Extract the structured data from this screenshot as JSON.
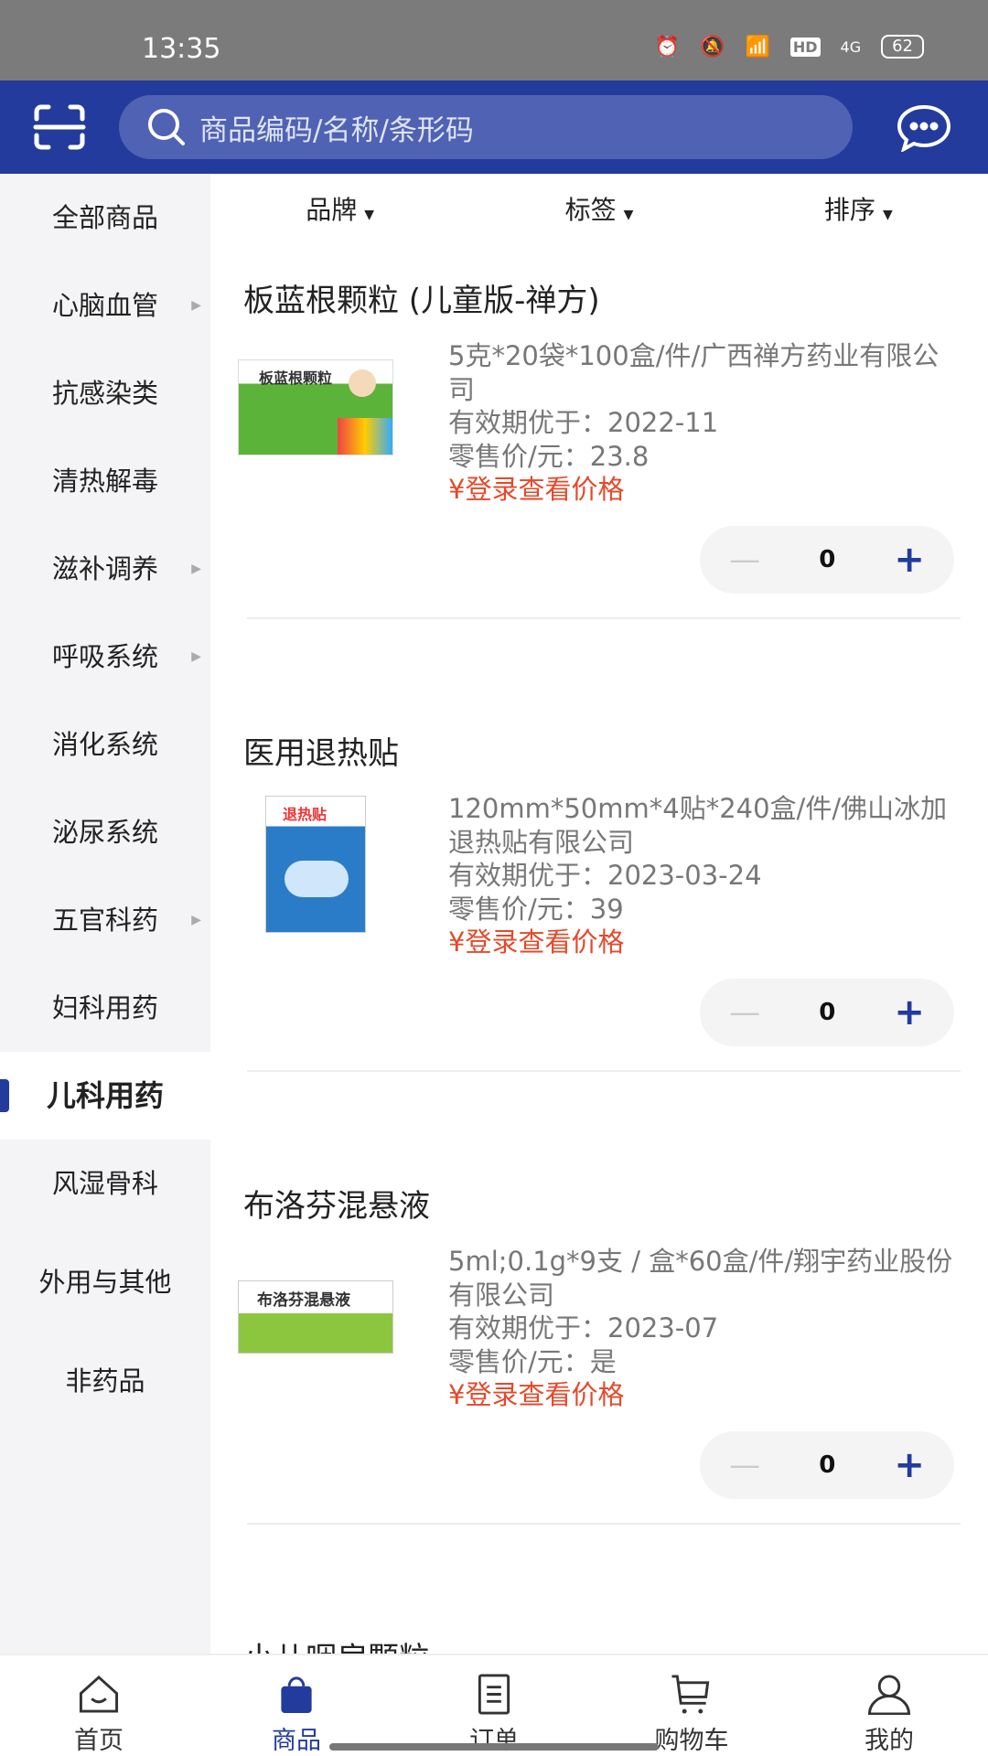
{
  "status_bar": {
    "time": "13:35",
    "battery": "62",
    "network": "4G",
    "hd": "HD"
  },
  "header": {
    "search_placeholder": "商品编码/名称/条形码",
    "icons": [
      "scan-icon",
      "search-icon",
      "chat-icon"
    ]
  },
  "colors": {
    "primary": "#233b9c",
    "price_login": "#e4492a"
  },
  "sidebar": {
    "items": [
      {
        "label": "全部商品",
        "arrow": false
      },
      {
        "label": "心脑血管",
        "arrow": true
      },
      {
        "label": "抗感染类",
        "arrow": false
      },
      {
        "label": "清热解毒",
        "arrow": false
      },
      {
        "label": "滋补调养",
        "arrow": true
      },
      {
        "label": "呼吸系统",
        "arrow": true
      },
      {
        "label": "消化系统",
        "arrow": false
      },
      {
        "label": "泌尿系统",
        "arrow": false
      },
      {
        "label": "五官科药",
        "arrow": true
      },
      {
        "label": "妇科用药",
        "arrow": false
      },
      {
        "label": "儿科用药",
        "arrow": false,
        "active": true
      },
      {
        "label": "风湿骨科",
        "arrow": false
      },
      {
        "label": "外用与其他",
        "arrow": false
      },
      {
        "label": "非药品",
        "arrow": false
      }
    ]
  },
  "filters": [
    {
      "label": "品牌"
    },
    {
      "label": "标签"
    },
    {
      "label": "排序"
    }
  ],
  "products": [
    {
      "name": "板蓝根颗粒 (儿童版-禅方)",
      "spec": "5克*20袋*100盒/件/广西禅方药业有限公司",
      "expiry": "有效期优于：2022-11",
      "retail": "零售价/元：23.8",
      "login_price": "¥登录查看价格",
      "qty": "0",
      "image_text": "板蓝根颗粒"
    },
    {
      "name": "医用退热贴",
      "spec": "120mm*50mm*4贴*240盒/件/佛山冰加退热贴有限公司",
      "expiry": "有效期优于：2023-03-24",
      "retail": "零售价/元：39",
      "login_price": "¥登录查看价格",
      "qty": "0",
      "image_text": "退热贴"
    },
    {
      "name": "布洛芬混悬液",
      "spec": "5ml;0.1g*9支 / 盒*60盒/件/翔宇药业股份有限公司",
      "expiry": "有效期优于：2023-07",
      "retail": "零售价/元：是",
      "login_price": "¥登录查看价格",
      "qty": "0",
      "image_text": "布洛芬混悬液"
    },
    {
      "name": "小儿咽扁颗粒"
    }
  ],
  "stepper": {
    "minus": "—",
    "plus": "+"
  },
  "bottom_nav": [
    {
      "label": "首页",
      "icon": "home-icon"
    },
    {
      "label": "商品",
      "icon": "bag-icon",
      "active": true
    },
    {
      "label": "订单",
      "icon": "order-icon"
    },
    {
      "label": "购物车",
      "icon": "cart-icon"
    },
    {
      "label": "我的",
      "icon": "user-icon"
    }
  ]
}
